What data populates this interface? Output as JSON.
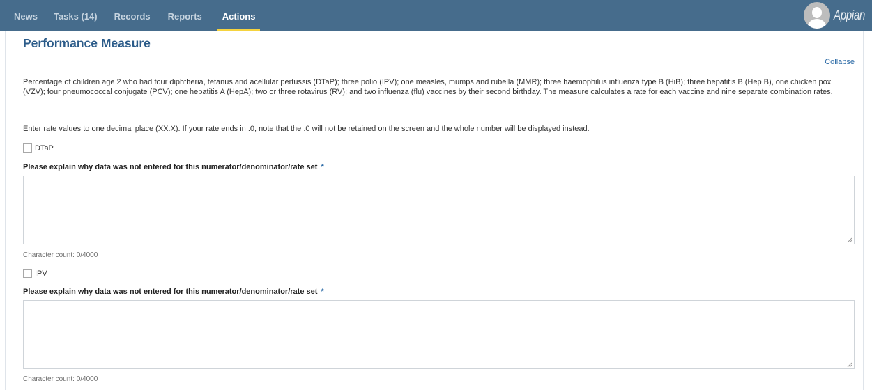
{
  "header": {
    "nav": [
      {
        "label": "News",
        "active": false
      },
      {
        "label": "Tasks (14)",
        "active": false
      },
      {
        "label": "Records",
        "active": false
      },
      {
        "label": "Reports",
        "active": false
      },
      {
        "label": "Actions",
        "active": true
      }
    ],
    "brand": "Appian",
    "avatar_icon": "user-avatar-icon",
    "colors": {
      "bar": "#466c8c",
      "active_underline": "#f5d33f"
    }
  },
  "section": {
    "title": "Performance Measure",
    "collapse_label": "Collapse",
    "description": "Percentage of children age 2 who had four diphtheria, tetanus and acellular pertussis (DTaP); three polio (IPV); one measles, mumps and rubella (MMR); three haemophilus influenza type B (HiB); three hepatitis B (Hep B), one chicken pox (VZV); four pneumococcal conjugate (PCV); one hepatitis A (HepA); two or three rotavirus (RV); and two influenza (flu) vaccines by their second birthday. The measure calculates a rate for each vaccine and nine separate combination rates.",
    "note": "Enter rate values to one decimal place (XX.X). If your rate ends in .0, note that the .0 will not be retained on the screen and the whole number will be displayed instead."
  },
  "vaccines": [
    {
      "checkbox_label": "DTaP",
      "checked": false,
      "field_label": "Please explain why data was not entered for this numerator/denominator/rate set",
      "required_marker": "*",
      "value": "",
      "char_count": "Character count: 0/4000"
    },
    {
      "checkbox_label": "IPV",
      "checked": false,
      "field_label": "Please explain why data was not entered for this numerator/denominator/rate set",
      "required_marker": "*",
      "value": "",
      "char_count": "Character count: 0/4000"
    }
  ]
}
